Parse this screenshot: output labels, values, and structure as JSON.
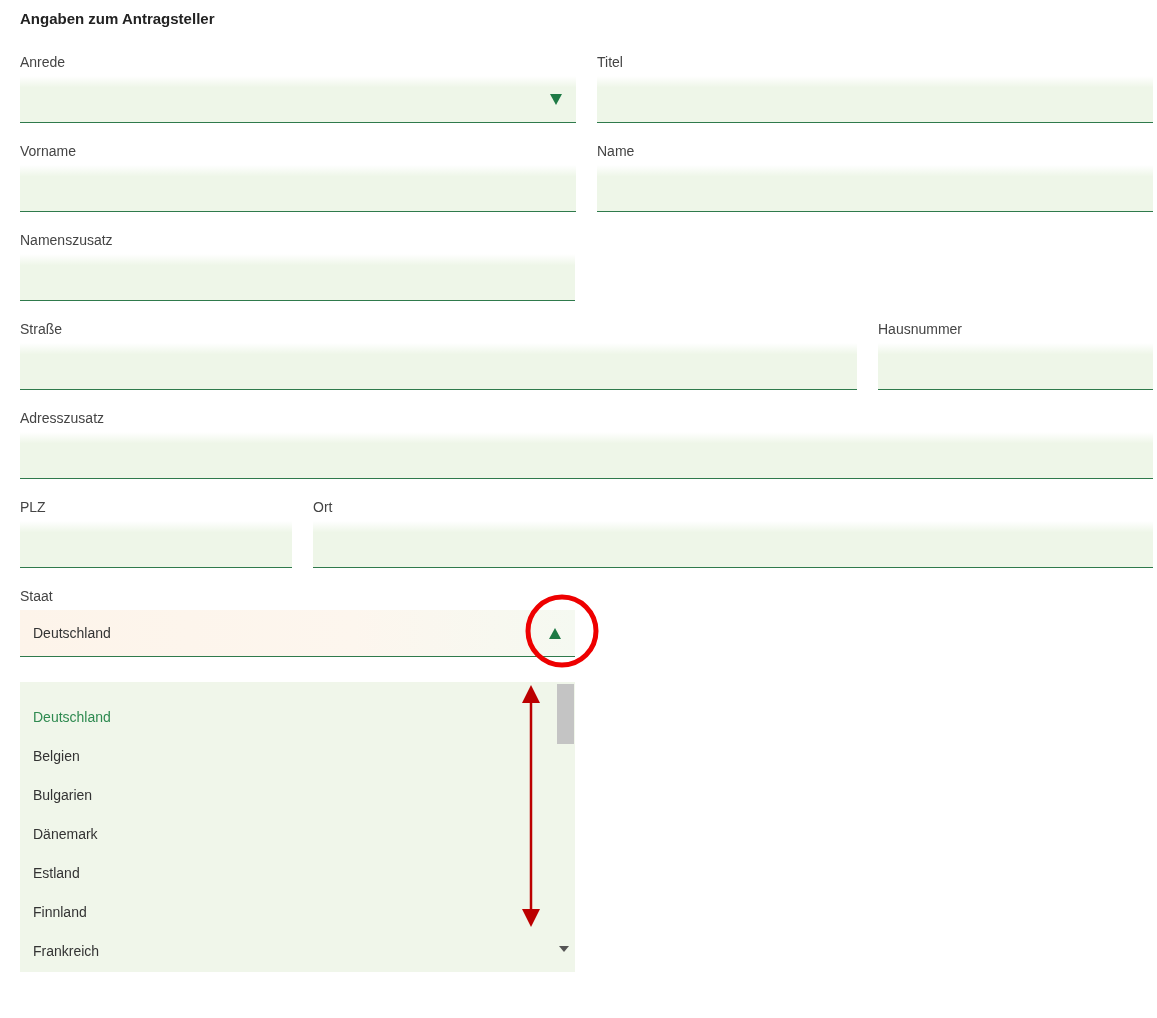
{
  "heading": "Angaben zum Antragsteller",
  "rows": [
    {
      "kind": "halves",
      "fields": [
        {
          "label": "Anrede",
          "kind": "select",
          "expanded": false
        },
        {
          "label": "Titel",
          "kind": "text"
        }
      ]
    },
    {
      "kind": "halves",
      "fields": [
        {
          "label": "Vorname",
          "kind": "text"
        },
        {
          "label": "Name",
          "kind": "text"
        }
      ]
    },
    {
      "kind": "half",
      "fields": [
        {
          "label": "Namenszusatz",
          "kind": "text"
        }
      ]
    },
    {
      "kind": "wide-narrow",
      "fields": [
        {
          "label": "Straße",
          "kind": "text"
        },
        {
          "label": "Hausnummer",
          "kind": "text"
        }
      ]
    },
    {
      "kind": "full",
      "fields": [
        {
          "label": "Adresszusatz",
          "kind": "text"
        }
      ]
    },
    {
      "kind": "narrow-wide",
      "fields": [
        {
          "label": "PLZ",
          "kind": "text"
        },
        {
          "label": "Ort",
          "kind": "text"
        }
      ]
    },
    {
      "kind": "half",
      "fields": [
        {
          "label": "Staat",
          "kind": "select",
          "value": "Deutschland",
          "expanded": true,
          "options": [
            {
              "label": "Deutschland",
              "selected": true
            },
            {
              "label": "Belgien",
              "selected": false
            },
            {
              "label": "Bulgarien",
              "selected": false
            },
            {
              "label": "Dänemark",
              "selected": false
            },
            {
              "label": "Estland",
              "selected": false
            },
            {
              "label": "Finnland",
              "selected": false
            },
            {
              "label": "Frankreich",
              "selected": false
            }
          ]
        }
      ]
    }
  ]
}
